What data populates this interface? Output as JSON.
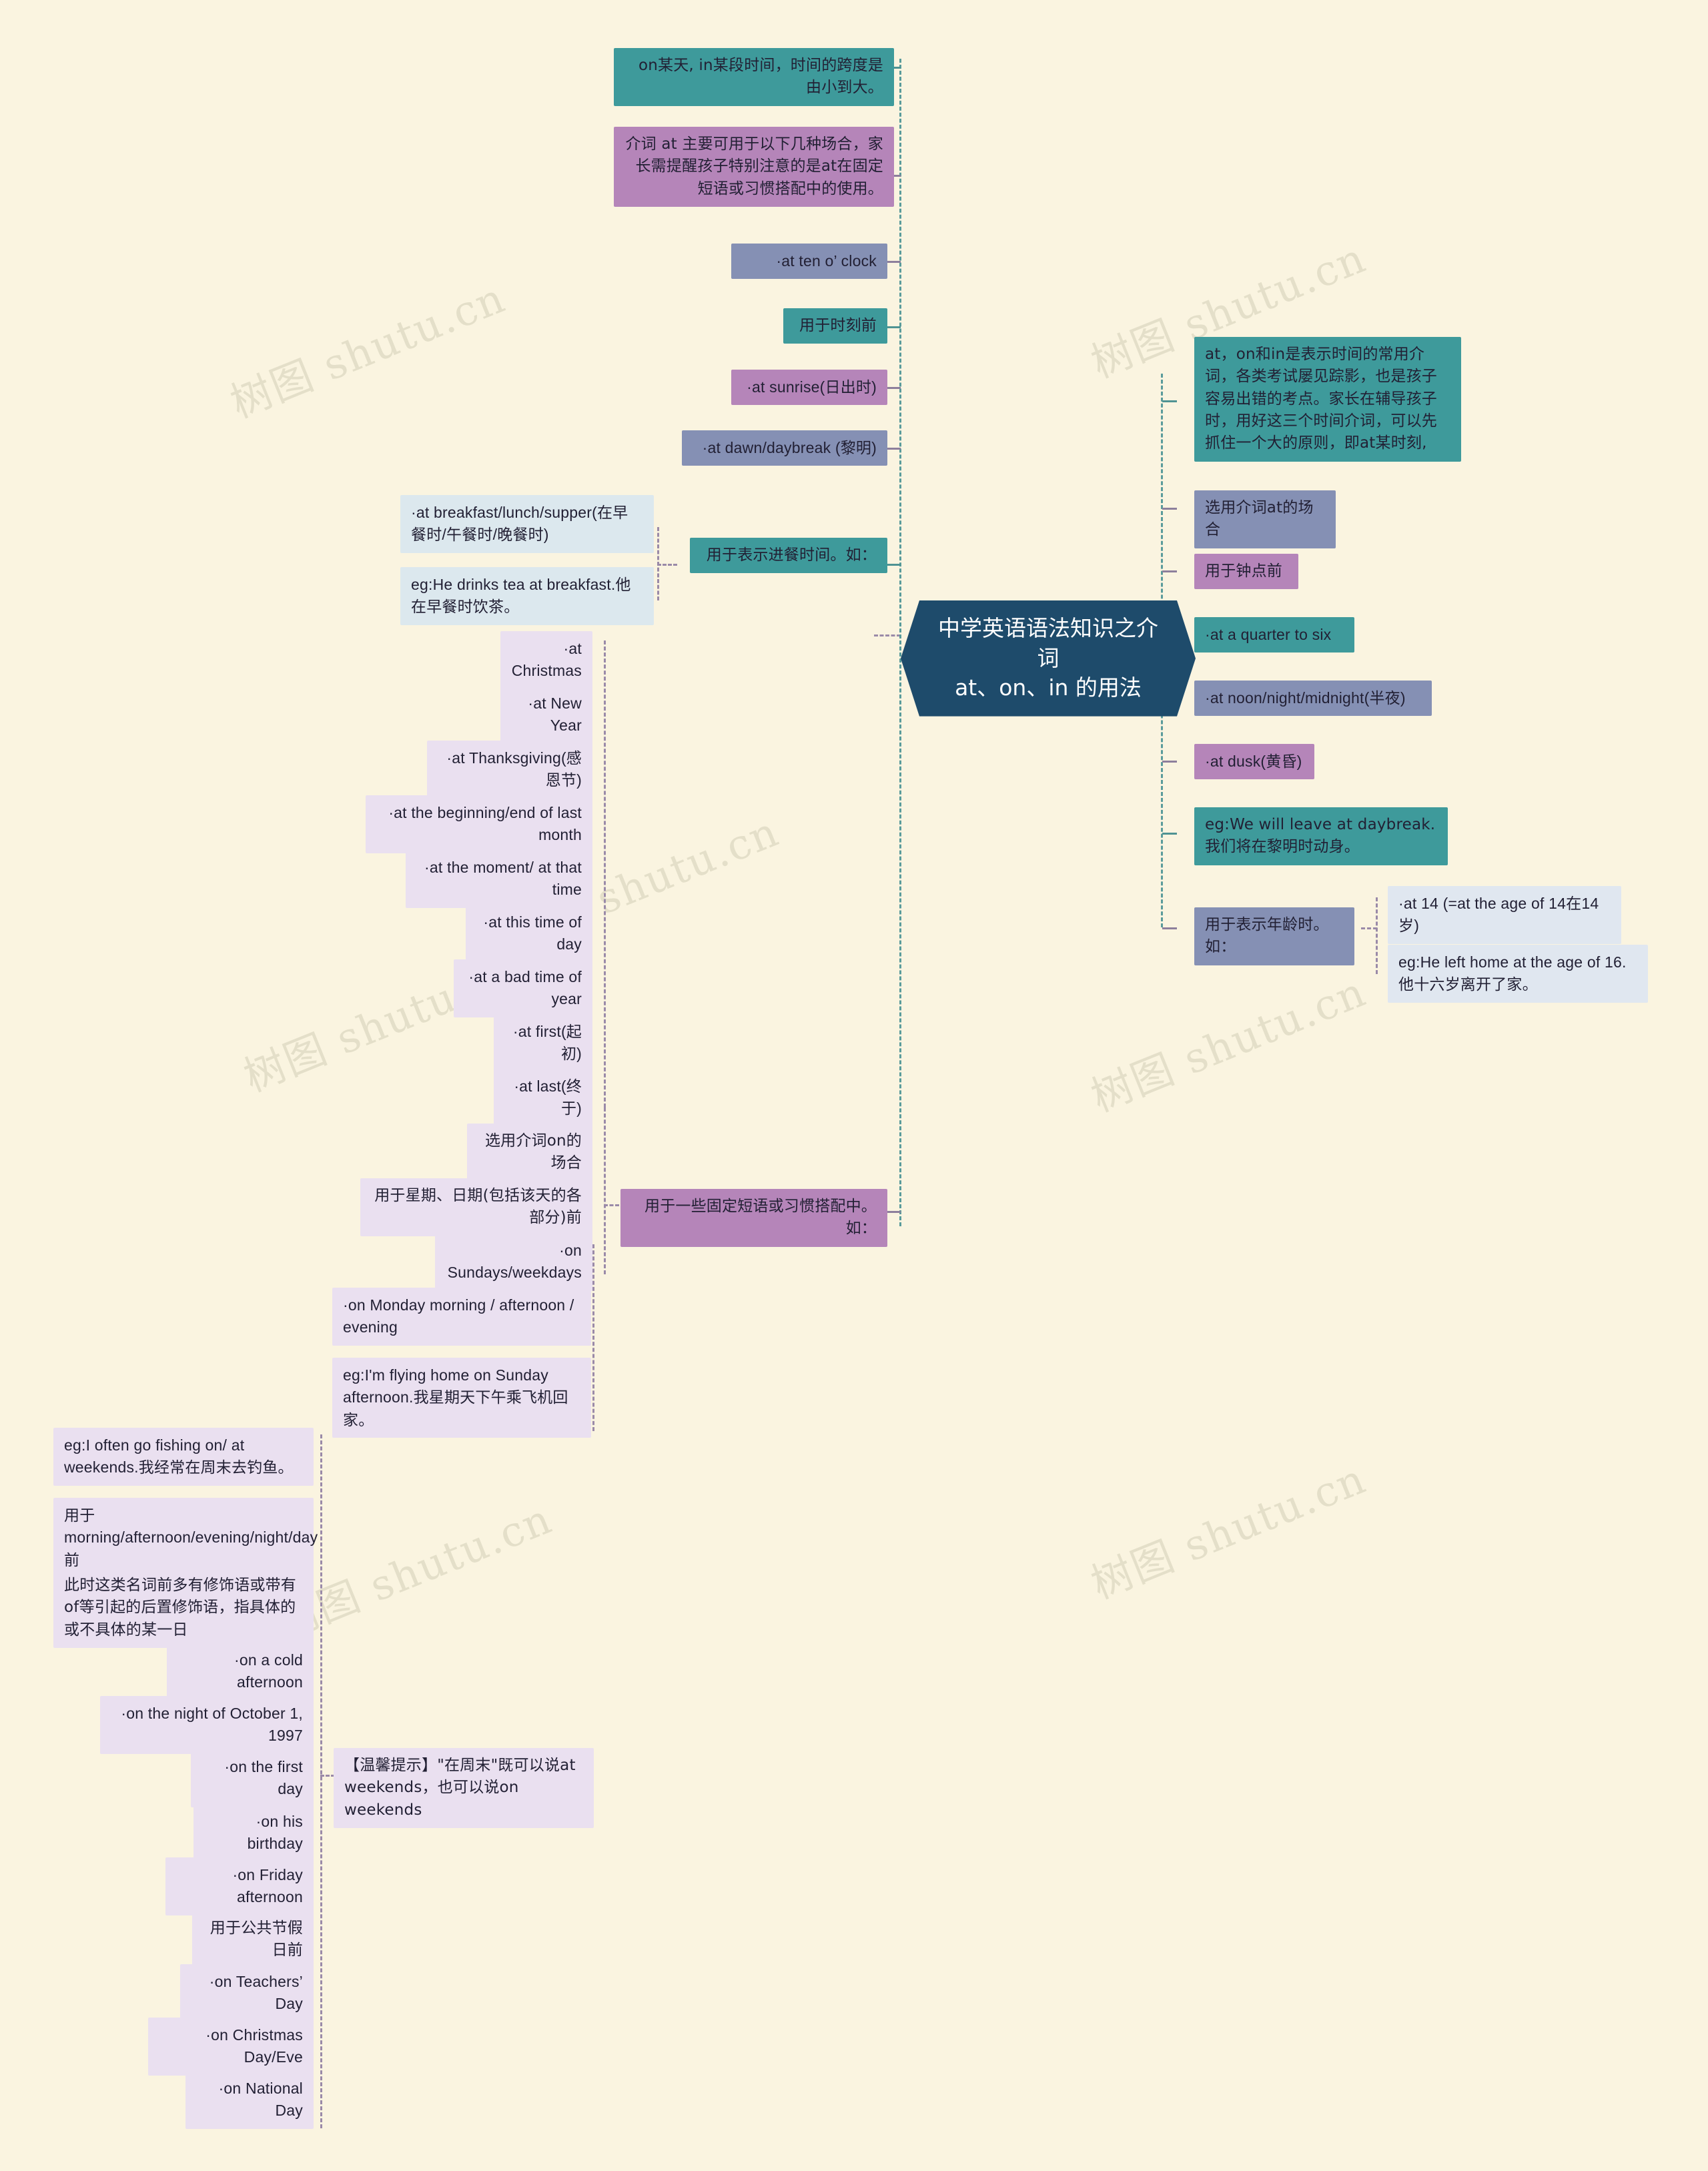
{
  "central": {
    "line1": "中学英语语法知识之介词",
    "line2": "at、on、in 的用法"
  },
  "colors": {
    "background": "#FAF4E0",
    "central_fill": "#1E4B6B",
    "teal": "#3E9A9B",
    "mauve": "#B585B9",
    "slate": "#8590B4",
    "lavender": "#EAE0F0",
    "pale_blue": "#DCE8EE",
    "connector": "#9A8AA8"
  },
  "watermarks": [
    "树图 shutu.cn",
    "树图 shutu.cn",
    "树图 shutu.cn",
    "树图 shutu.cn",
    "树图 shutu.cn",
    "树图 shutu.cn",
    "树图 shutu.cn"
  ],
  "nodes": {
    "intro_on_in": "on某天, in某段时间，时间的跨度是由小到大。",
    "at_intro": "介词 at 主要可用于以下几种场合，家长需提醒孩子特别注意的是at在固定短语或习惯搭配中的使用。",
    "at_ten": "·at ten o’  clock",
    "for_clock_time": "用于时刻前",
    "at_sunrise": "·at sunrise(日出时)",
    "at_dawn": "·at dawn/daybreak (黎明)",
    "at_meal": "·at breakfast/lunch/supper(在早餐时/午餐时/晚餐时)",
    "eg_breakfast": "eg:He drinks tea at breakfast.他在早餐时饮茶。",
    "for_meal_time": "用于表示进餐时间。如：",
    "at_christmas": "·at Christmas",
    "at_new_year": "·at New Year",
    "at_thanksgiving": "·at Thanksgiving(感恩节)",
    "at_begin_end": "·at the beginning/end of last month",
    "at_moment": "·at the moment/ at that time",
    "at_this_time": "·at this time of day",
    "at_bad_time": "·at a bad time of year",
    "at_first": "·at first(起初)",
    "at_last": "·at last(终于)",
    "on_cases": "选用介词on的场合",
    "for_weekday_date": "用于星期、日期(包括该天的各部分)前",
    "fixed_phrases": "用于一些固定短语或习惯搭配中。如：",
    "on_sundays": "·on Sundays/weekdays",
    "on_monday_parts": "·on Monday morning / afternoon / evening",
    "eg_flying_home": "eg:I'm flying home on Sunday afternoon.我星期天下午乘飞机回家。",
    "eg_fishing": "eg:I often go fishing on/ at weekends.我经常在周末去钓鱼。",
    "for_parts_of_day": "用于morning/afternoon/evening/night/day前",
    "modifier_note": "此时这类名词前多有修饰语或带有of等引起的后置修饰语，指具体的或不具体的某一日",
    "on_cold_afternoon": "·on a cold afternoon",
    "on_night_oct": "·on the night of October 1, 1997",
    "on_first_day": "·on the first day",
    "tip_weekends": "【温馨提示】\"在周末\"既可以说at weekends，也可以说on weekends",
    "on_his_birthday": "·on his birthday",
    "on_friday_afternoon": "·on Friday afternoon",
    "for_public_holiday": "用于公共节假日前",
    "on_teachers_day": "·on Teachers’   Day",
    "on_christmas_day": "·on Christmas Day/Eve",
    "on_national_day": "·on National Day",
    "overview": "at，on和in是表示时间的常用介词，各类考试屡见踪影，也是孩子容易出错的考点。家长在辅导孩子时，用好这三个时间介词，可以先抓住一个大的原则，即at某时刻,",
    "at_cases": "选用介词at的场合",
    "for_oclock": "用于钟点前",
    "at_quarter": "·at a quarter to six",
    "at_noon_night": "·at noon/night/midnight(半夜)",
    "at_dusk": "·at dusk(黄昏)",
    "eg_daybreak": "eg:We will leave at daybreak.我们将在黎明时动身。",
    "for_age": "用于表示年龄时。如：",
    "at_14": "·at 14 (=at the age of 14在14岁)",
    "eg_left_home": "eg:He left home at the age of 16.他十六岁离开了家。"
  }
}
